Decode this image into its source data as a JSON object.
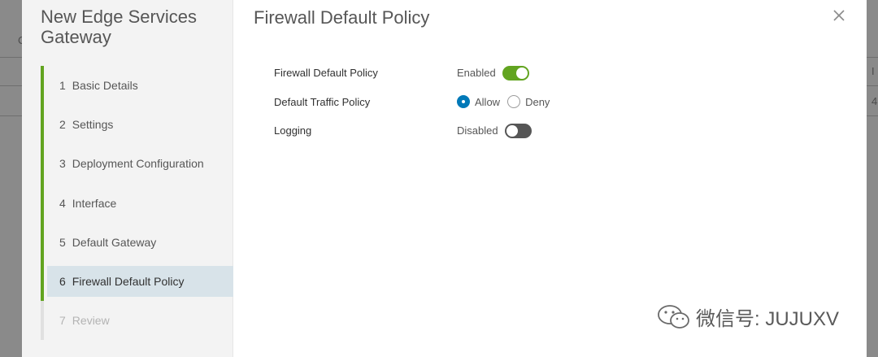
{
  "wizard": {
    "title": "New Edge Services Gateway",
    "steps": [
      {
        "num": "1",
        "label": "Basic Details",
        "state": "completed"
      },
      {
        "num": "2",
        "label": "Settings",
        "state": "completed"
      },
      {
        "num": "3",
        "label": "Deployment Configuration",
        "state": "completed"
      },
      {
        "num": "4",
        "label": "Interface",
        "state": "completed"
      },
      {
        "num": "5",
        "label": "Default Gateway",
        "state": "completed"
      },
      {
        "num": "6",
        "label": "Firewall Default Policy",
        "state": "active"
      },
      {
        "num": "7",
        "label": "Review",
        "state": "disabled"
      }
    ]
  },
  "page": {
    "title": "Firewall Default Policy"
  },
  "form": {
    "firewall_policy": {
      "label": "Firewall Default Policy",
      "status": "Enabled",
      "on": true
    },
    "traffic_policy": {
      "label": "Default Traffic Policy",
      "options": [
        "Allow",
        "Deny"
      ],
      "selected": "Allow"
    },
    "logging": {
      "label": "Logging",
      "status": "Disabled",
      "on": false
    }
  },
  "watermark": {
    "text": "微信号: JUJUXV"
  },
  "background": {
    "right_header": "I",
    "right_cell": "4",
    "left_partial": "C"
  },
  "colors": {
    "accent_green": "#62a420",
    "radio_blue": "#0079b8",
    "active_step_bg": "#d8e3e9"
  }
}
